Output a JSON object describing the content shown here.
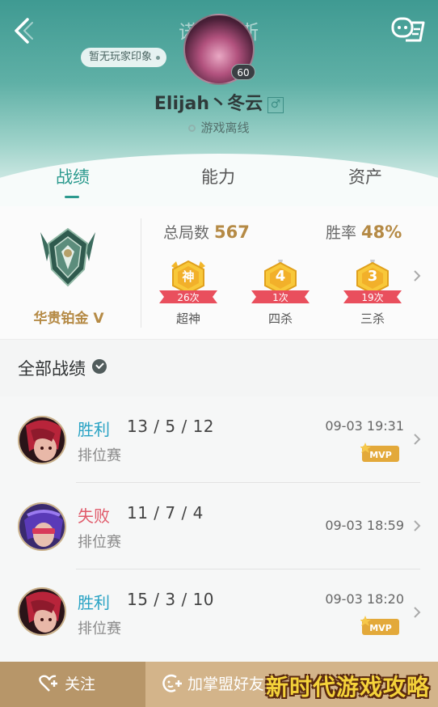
{
  "header": {
    "hero_name": "诺克萨斯",
    "impression": "暂无玩家印象",
    "level": "60",
    "player_name": "Elijah丶冬云",
    "gender_symbol": "♂",
    "status": "游戏离线"
  },
  "tabs": [
    {
      "label": "战绩",
      "active": true
    },
    {
      "label": "能力",
      "active": false
    },
    {
      "label": "资产",
      "active": false
    }
  ],
  "stats": {
    "rank": "华贵铂金 V",
    "total_label": "总局数",
    "total_value": "567",
    "winrate_label": "胜率",
    "winrate_value": "48%",
    "medals": [
      {
        "symbol": "神",
        "count": "26次",
        "label": "超神"
      },
      {
        "symbol": "4",
        "count": "1次",
        "label": "四杀"
      },
      {
        "symbol": "3",
        "count": "19次",
        "label": "三杀"
      }
    ]
  },
  "section": {
    "title": "全部战绩"
  },
  "matches": [
    {
      "result": "胜利",
      "kda": "13 / 5 / 12",
      "mode": "排位赛",
      "time": "09-03 19:31",
      "mvp": true
    },
    {
      "result": "失败",
      "kda": "11 / 7 / 4",
      "mode": "排位赛",
      "time": "09-03 18:59",
      "mvp": false
    },
    {
      "result": "胜利",
      "kda": "15 / 3 / 10",
      "mode": "排位赛",
      "time": "09-03 18:20",
      "mvp": true
    }
  ],
  "mvp_label": "MVP",
  "bottom": {
    "follow": "关注",
    "add_friend": "加掌盟好友",
    "watermark": "新时代游戏攻略"
  },
  "colors": {
    "accent": "#2c9a8e",
    "gold": "#b58a45",
    "win": "#29a3c4",
    "lose": "#e05a6a",
    "bottom_bar": "#d3b48a"
  }
}
